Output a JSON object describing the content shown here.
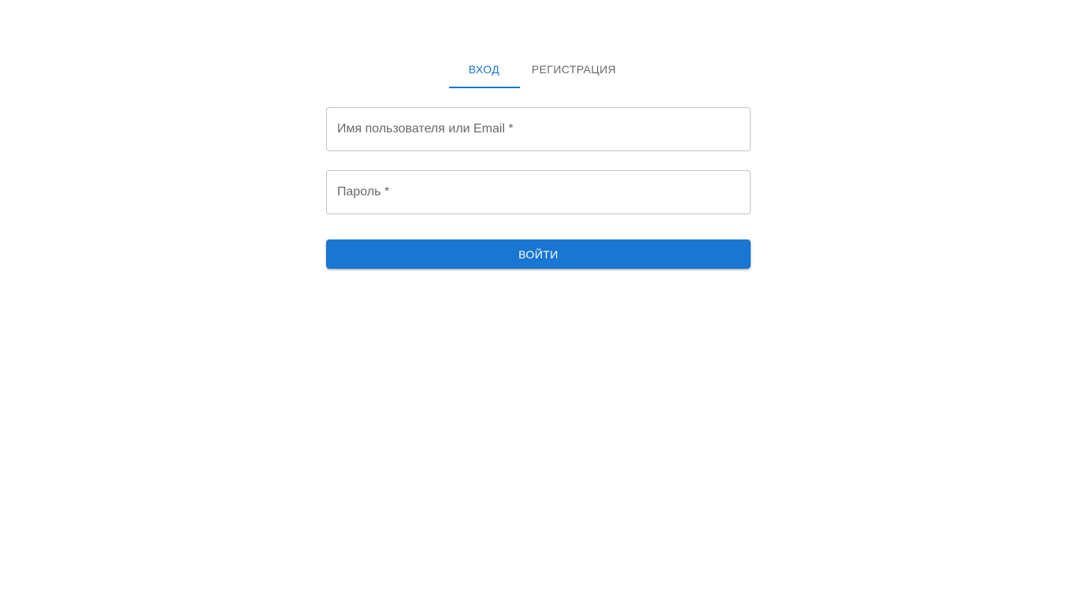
{
  "tabs": {
    "login_label": "Вход",
    "register_label": "Регистрация",
    "active": "login"
  },
  "form": {
    "username_label": "Имя пользователя или Email *",
    "username_value": "",
    "password_label": "Пароль *",
    "password_value": "",
    "submit_label": "Войти"
  },
  "colors": {
    "primary": "#1976d2",
    "text_secondary": "#666666",
    "border": "#c4c4c4",
    "background": "#ffffff"
  }
}
